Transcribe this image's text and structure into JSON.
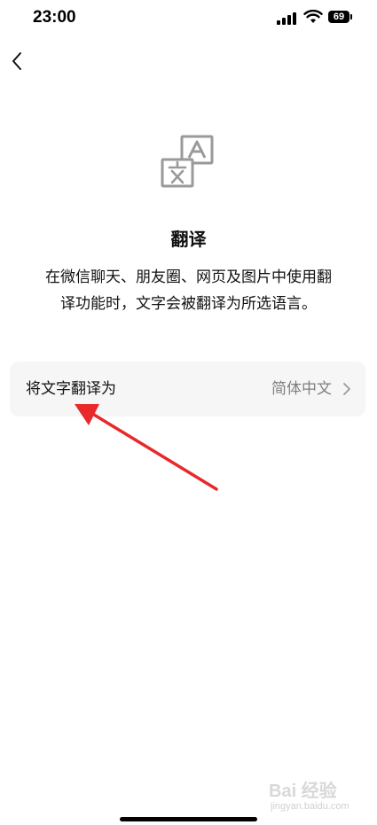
{
  "status_bar": {
    "time": "23:00",
    "battery_level": "69"
  },
  "nav": {
    "back_icon": "chevron-left-icon"
  },
  "header": {
    "icon": "translate-icon",
    "title": "翻译",
    "description_line1": "在微信聊天、朋友圈、网页及图片中使用翻",
    "description_line2": "译功能时，文字会被翻译为所选语言。"
  },
  "settings": {
    "translate_to_label": "将文字翻译为",
    "translate_to_value": "简体中文"
  },
  "watermark": {
    "logo": "Bai 经验",
    "sub": "jingyan.baidu.com"
  },
  "colors": {
    "arrow": "#e8282b",
    "row_background": "#f6f6f6",
    "secondary_text": "#7f7f7f"
  }
}
